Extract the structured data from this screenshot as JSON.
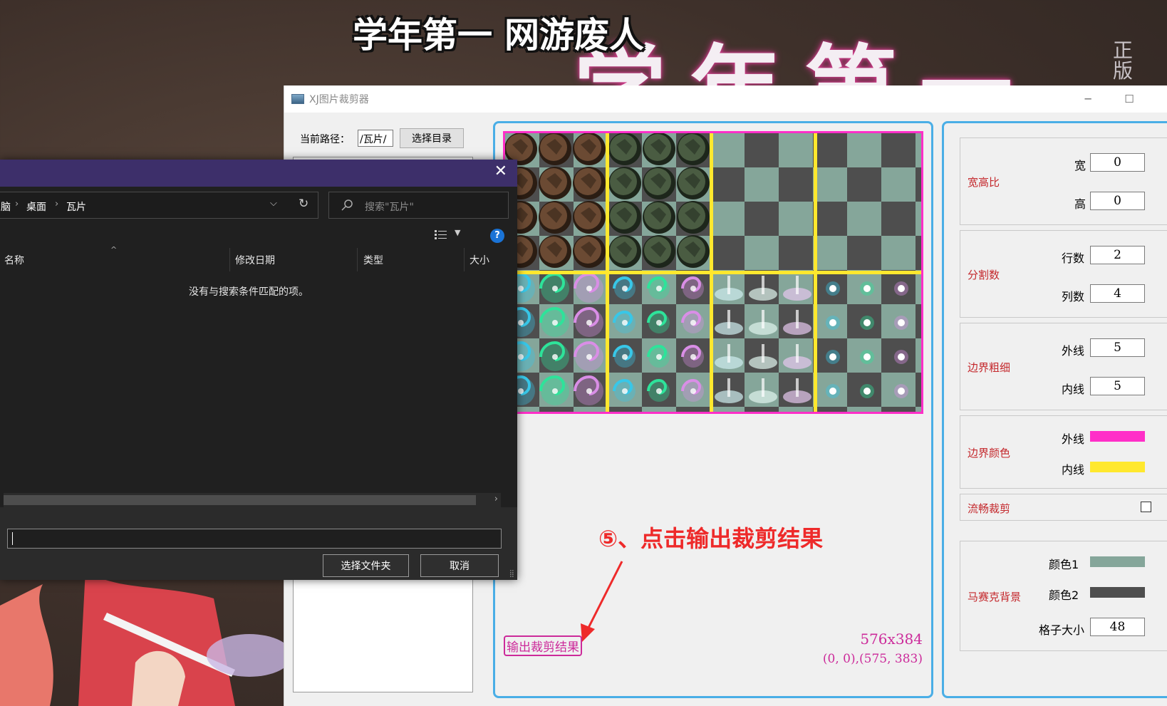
{
  "video": {
    "subtitle": "学年第一 网游废人",
    "big_title": "学年第一",
    "zheng_ban": "正版"
  },
  "app": {
    "title": "XJ图片裁剪器",
    "path_label": "当前路径：",
    "path_value": "/瓦片/",
    "select_dir_button": "选择目录",
    "preview": {
      "size_text": "576x384",
      "coord_text": "(0,  0),(575,  383)",
      "output_button": "输出裁剪结果"
    },
    "annotation": "⑤、点击输出裁剪结果",
    "settings": {
      "aspect": {
        "title": "宽高比",
        "width_label": "宽",
        "width_value": "0",
        "height_label": "高",
        "height_value": "0"
      },
      "split": {
        "title": "分割数",
        "rows_label": "行数",
        "rows_value": "2",
        "cols_label": "列数",
        "cols_value": "4"
      },
      "border_width": {
        "title": "边界粗细",
        "outer_label": "外线",
        "outer_value": "5",
        "inner_label": "内线",
        "inner_value": "5"
      },
      "border_color": {
        "title": "边界颜色",
        "outer_label": "外线",
        "outer_color": "#ff2fc8",
        "inner_label": "内线",
        "inner_color": "#ffe82e"
      },
      "smooth_crop": {
        "title": "流畅裁剪",
        "checked": false
      },
      "mosaic": {
        "title": "马赛克背景",
        "color1_label": "颜色1",
        "color1": "#85a69a",
        "color2_label": "颜色2",
        "color2": "#4e4e4e",
        "cell_label": "格子大小",
        "cell_value": "48"
      }
    }
  },
  "dialog": {
    "breadcrumb": [
      "脑",
      "桌面",
      "瓦片"
    ],
    "search_placeholder": "搜索\"瓦片\"",
    "columns": [
      "名称",
      "修改日期",
      "类型",
      "大小"
    ],
    "empty_message": "没有与搜索条件匹配的项。",
    "name_value": "",
    "ok_button": "选择文件夹",
    "cancel_button": "取消"
  },
  "colors": {
    "panel_border": "#4aaee6",
    "accent_text": "#cc2a9a",
    "group_title": "#c4282c",
    "dialog_titlebar": "#3d2f6a"
  },
  "tiles": {
    "blocks": [
      {
        "kind": "rock-brown"
      },
      {
        "kind": "rock-green"
      },
      {
        "kind": "empty"
      },
      {
        "kind": "empty"
      },
      {
        "kind": "swirl"
      },
      {
        "kind": "swirl-small"
      },
      {
        "kind": "light-pillar"
      },
      {
        "kind": "orb"
      }
    ]
  }
}
